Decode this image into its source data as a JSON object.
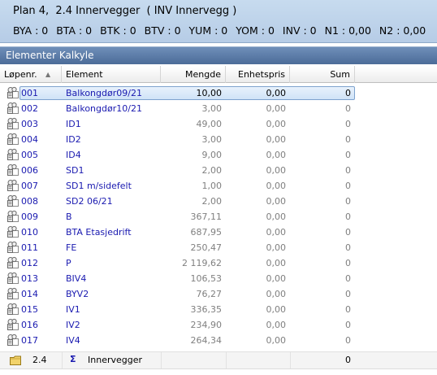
{
  "header": {
    "plan_label": "Plan 4,",
    "plan_section": "2.4 Innervegger",
    "plan_sub": "( INV Innervegg )",
    "stats": [
      "BYA : 0",
      "BTA : 0",
      "BTK : 0",
      "BTV : 0",
      "YUM : 0",
      "YOM : 0",
      "INV : 0",
      "N1 : 0,00",
      "N2 : 0,00"
    ]
  },
  "section_title": "Elementer Kalkyle",
  "columns": {
    "nr": "Løpenr.",
    "element": "Element",
    "mengde": "Mengde",
    "enhetspris": "Enhetspris",
    "sum": "Sum"
  },
  "rows": [
    {
      "nr": "001",
      "element": "Balkongdør09/21",
      "mengde": "10,00",
      "enhetspris": "0,00",
      "sum": "0"
    },
    {
      "nr": "002",
      "element": "Balkongdør10/21",
      "mengde": "3,00",
      "enhetspris": "0,00",
      "sum": "0"
    },
    {
      "nr": "003",
      "element": "ID1",
      "mengde": "49,00",
      "enhetspris": "0,00",
      "sum": "0"
    },
    {
      "nr": "004",
      "element": "ID2",
      "mengde": "3,00",
      "enhetspris": "0,00",
      "sum": "0"
    },
    {
      "nr": "005",
      "element": "ID4",
      "mengde": "9,00",
      "enhetspris": "0,00",
      "sum": "0"
    },
    {
      "nr": "006",
      "element": "SD1",
      "mengde": "2,00",
      "enhetspris": "0,00",
      "sum": "0"
    },
    {
      "nr": "007",
      "element": "SD1 m/sidefelt",
      "mengde": "1,00",
      "enhetspris": "0,00",
      "sum": "0"
    },
    {
      "nr": "008",
      "element": "SD2 06/21",
      "mengde": "2,00",
      "enhetspris": "0,00",
      "sum": "0"
    },
    {
      "nr": "009",
      "element": "B",
      "mengde": "367,11",
      "enhetspris": "0,00",
      "sum": "0"
    },
    {
      "nr": "010",
      "element": "BTA Etasjedrift",
      "mengde": "687,95",
      "enhetspris": "0,00",
      "sum": "0"
    },
    {
      "nr": "011",
      "element": "FE",
      "mengde": "250,47",
      "enhetspris": "0,00",
      "sum": "0"
    },
    {
      "nr": "012",
      "element": "P",
      "mengde": "2 119,62",
      "enhetspris": "0,00",
      "sum": "0"
    },
    {
      "nr": "013",
      "element": "BIV4",
      "mengde": "106,53",
      "enhetspris": "0,00",
      "sum": "0"
    },
    {
      "nr": "014",
      "element": "BYV2",
      "mengde": "76,27",
      "enhetspris": "0,00",
      "sum": "0"
    },
    {
      "nr": "015",
      "element": "IV1",
      "mengde": "336,35",
      "enhetspris": "0,00",
      "sum": "0"
    },
    {
      "nr": "016",
      "element": "IV2",
      "mengde": "234,90",
      "enhetspris": "0,00",
      "sum": "0"
    },
    {
      "nr": "017",
      "element": "IV4",
      "mengde": "264,34",
      "enhetspris": "0,00",
      "sum": "0"
    }
  ],
  "selected_index": 0,
  "footer": {
    "nr": "2.4",
    "sigma": "Σ",
    "label": "Innervegger",
    "sum": "0"
  },
  "icons": {
    "row": "element-item-icon",
    "footer": "folder-icon"
  },
  "colors": {
    "link_text": "#1a1ab0",
    "muted_value": "#808080",
    "section_bar": "#5a7aa8",
    "header_band": "#bfd4ec",
    "selection": "#cfe3f7"
  }
}
